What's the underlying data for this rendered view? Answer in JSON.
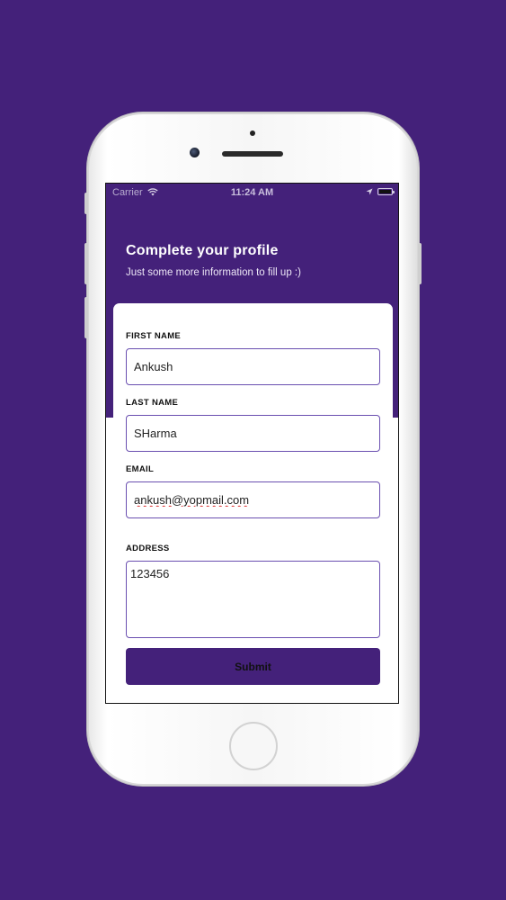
{
  "status_bar": {
    "carrier": "Carrier",
    "time": "11:24 AM",
    "icons": [
      "wifi-icon",
      "location-icon",
      "battery-icon"
    ]
  },
  "header": {
    "title": "Complete your profile",
    "subtitle": "Just some more information to fill up :)"
  },
  "form": {
    "first_name": {
      "label": "FIRST NAME",
      "value": "Ankush"
    },
    "last_name": {
      "label": "LAST NAME",
      "value": "SHarma"
    },
    "email": {
      "label": "EMAIL",
      "value": "ankush@yopmail.com"
    },
    "address": {
      "label": "ADDRESS",
      "value": "123456"
    },
    "submit_label": "Submit"
  },
  "colors": {
    "background": "#44217a",
    "accent": "#44217a",
    "input_border": "#6a4fb0",
    "card": "#ffffff"
  }
}
